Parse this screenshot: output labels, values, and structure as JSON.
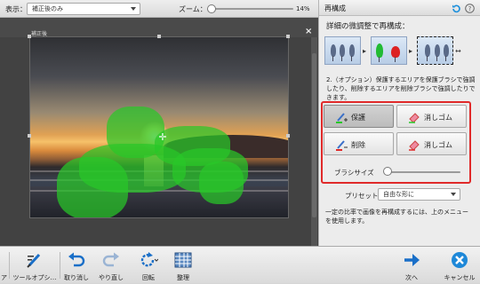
{
  "toolbar": {
    "view_label": "表示：",
    "view_value": "補正後のみ",
    "zoom_label": "ズーム：",
    "zoom_value": "14%",
    "zoom_level_percent": 14
  },
  "canvas": {
    "photo_label": "補正後",
    "close_glyph": "×",
    "crosshair_glyph": "✛"
  },
  "panel": {
    "title": "再構成",
    "subtitle": "詳細の微調整で再構成：",
    "instructions": "2.（オプション）保護するエリアを保護ブラシで強調したり、削除するエリアを削除ブラシで強調したりできます。",
    "tools": [
      {
        "label": "保護",
        "active": true
      },
      {
        "label": "消しゴム",
        "active": false
      },
      {
        "label": "削除",
        "active": false
      },
      {
        "label": "消しゴム",
        "active": false
      }
    ],
    "brush_size_label": "ブラシサイズ",
    "brush_size_fraction": 0.05,
    "preset_label": "プリセット",
    "preset_value": "自由な形に",
    "note": "一定の比率で画像を再構成するには、上のメニューを使用します。"
  },
  "bottom": {
    "tool_options": "ツールオプシ…",
    "undo": "取り消し",
    "redo": "やり直し",
    "rotate": "回転",
    "organize": "整理",
    "next": "次へ",
    "cancel": "キャンセル",
    "left_edge": "ア"
  },
  "colors": {
    "accent_blue": "#1a8fdc",
    "protect_green": "#28c828",
    "erase_red": "#e02a2a",
    "cancel_blue": "#1e88d8"
  },
  "icons": [
    "refresh-icon",
    "help-icon",
    "brush-icon",
    "undo-icon",
    "redo-icon",
    "rotate-icon",
    "grid-icon",
    "next-arrow-icon",
    "cancel-icon"
  ]
}
